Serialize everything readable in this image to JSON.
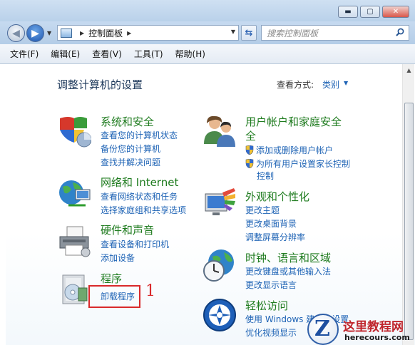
{
  "window": {
    "controls": {
      "minimize": "▬",
      "maximize": "▢",
      "close": "✕"
    }
  },
  "navbar": {
    "address": {
      "path": [
        "控制面板"
      ]
    },
    "search": {
      "placeholder": "搜索控制面板"
    }
  },
  "menubar": {
    "items": [
      "文件(F)",
      "编辑(E)",
      "查看(V)",
      "工具(T)",
      "帮助(H)"
    ]
  },
  "main": {
    "title": "调整计算机的设置",
    "view_by": {
      "label": "查看方式:",
      "value": "类别"
    },
    "left_categories": [
      {
        "title": "系统和安全",
        "icon": "shield-icon",
        "links": [
          "查看您的计算机状态",
          "备份您的计算机",
          "查找并解决问题"
        ]
      },
      {
        "title": "网络和 Internet",
        "icon": "network-globe-icon",
        "links": [
          "查看网络状态和任务",
          "选择家庭组和共享选项"
        ]
      },
      {
        "title": "硬件和声音",
        "icon": "printer-icon",
        "links": [
          "查看设备和打印机",
          "添加设备"
        ]
      },
      {
        "title": "程序",
        "icon": "programs-icon",
        "links": [
          "卸载程序"
        ]
      }
    ],
    "right_categories": [
      {
        "title": "用户帐户和家庭安全",
        "icon": "users-icon",
        "links": [
          "添加或删除用户帐户",
          "为所有用户设置家长控制"
        ]
      },
      {
        "title": "外观和个性化",
        "icon": "appearance-icon",
        "links": [
          "更改主题",
          "更改桌面背景",
          "调整屏幕分辨率"
        ]
      },
      {
        "title": "时钟、语言和区域",
        "icon": "clock-globe-icon",
        "links": [
          "更改键盘或其他输入法",
          "更改显示语言"
        ]
      },
      {
        "title": "轻松访问",
        "icon": "ease-of-access-icon",
        "links": [
          "使用 Windows 建议的设置",
          "优化视频显示"
        ]
      }
    ],
    "annotation": {
      "step": "1"
    }
  },
  "watermark": {
    "name": "这里教程网",
    "url": "herecours.com"
  },
  "colors": {
    "link": "#1e63b5",
    "category_title": "#1e7b1e",
    "annotation": "#d9292b"
  }
}
